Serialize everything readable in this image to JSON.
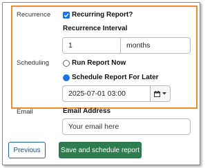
{
  "recurrence": {
    "label": "Recurrence",
    "checkbox_label": "Recurring Report?",
    "interval_label": "Recurrence Interval",
    "interval_value": "1",
    "interval_unit": "months"
  },
  "scheduling": {
    "label": "Scheduling",
    "options": [
      {
        "label": "Run Report Now",
        "selected": false
      },
      {
        "label": "Schedule Report For Later",
        "selected": true
      }
    ],
    "datetime_value": "2025-07-01 03:00"
  },
  "email": {
    "label": "Email",
    "field_label": "Email Address",
    "placeholder": "Your email here"
  },
  "buttons": {
    "previous": "Previous",
    "submit": "Save and schedule report"
  },
  "colors": {
    "highlight": "#f08a2a",
    "accent": "#1a73e8",
    "success": "#2e7d4f"
  },
  "icons": {
    "calendar": "calendar-icon",
    "caret": "caret-down-icon"
  }
}
